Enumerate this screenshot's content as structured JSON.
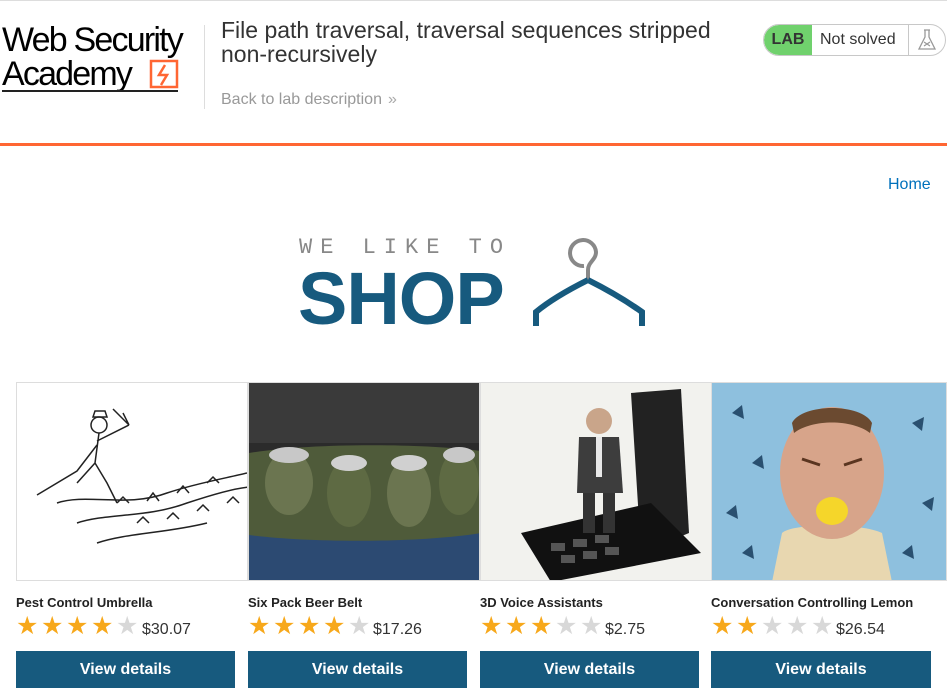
{
  "header": {
    "logo_line1": "Web Security",
    "logo_line2": "Academy",
    "lab_title": "File path traversal, traversal sequences stripped non-recursively",
    "back_link": "Back to lab description",
    "status_badge": "LAB",
    "status_text": "Not solved"
  },
  "nav": {
    "home": "Home"
  },
  "brand": {
    "tagline": "WE LIKE TO",
    "shop": "SHOP"
  },
  "colors": {
    "accent": "#ff6633",
    "primary": "#175a7e",
    "lab_green": "#70d16d",
    "star": "#f7a81b",
    "link": "#0071bc"
  },
  "products": [
    {
      "name": "Pest Control Umbrella",
      "price": "$30.07",
      "rating": 4,
      "button": "View details",
      "image": "umbrella-illustration"
    },
    {
      "name": "Six Pack Beer Belt",
      "price": "$17.26",
      "rating": 4,
      "button": "View details",
      "image": "beer-belt-photo"
    },
    {
      "name": "3D Voice Assistants",
      "price": "$2.75",
      "rating": 3,
      "button": "View details",
      "image": "figurine-phone-photo"
    },
    {
      "name": "Conversation Controlling Lemon",
      "price": "$26.54",
      "rating": 2,
      "button": "View details",
      "image": "lemon-man-photo"
    }
  ]
}
